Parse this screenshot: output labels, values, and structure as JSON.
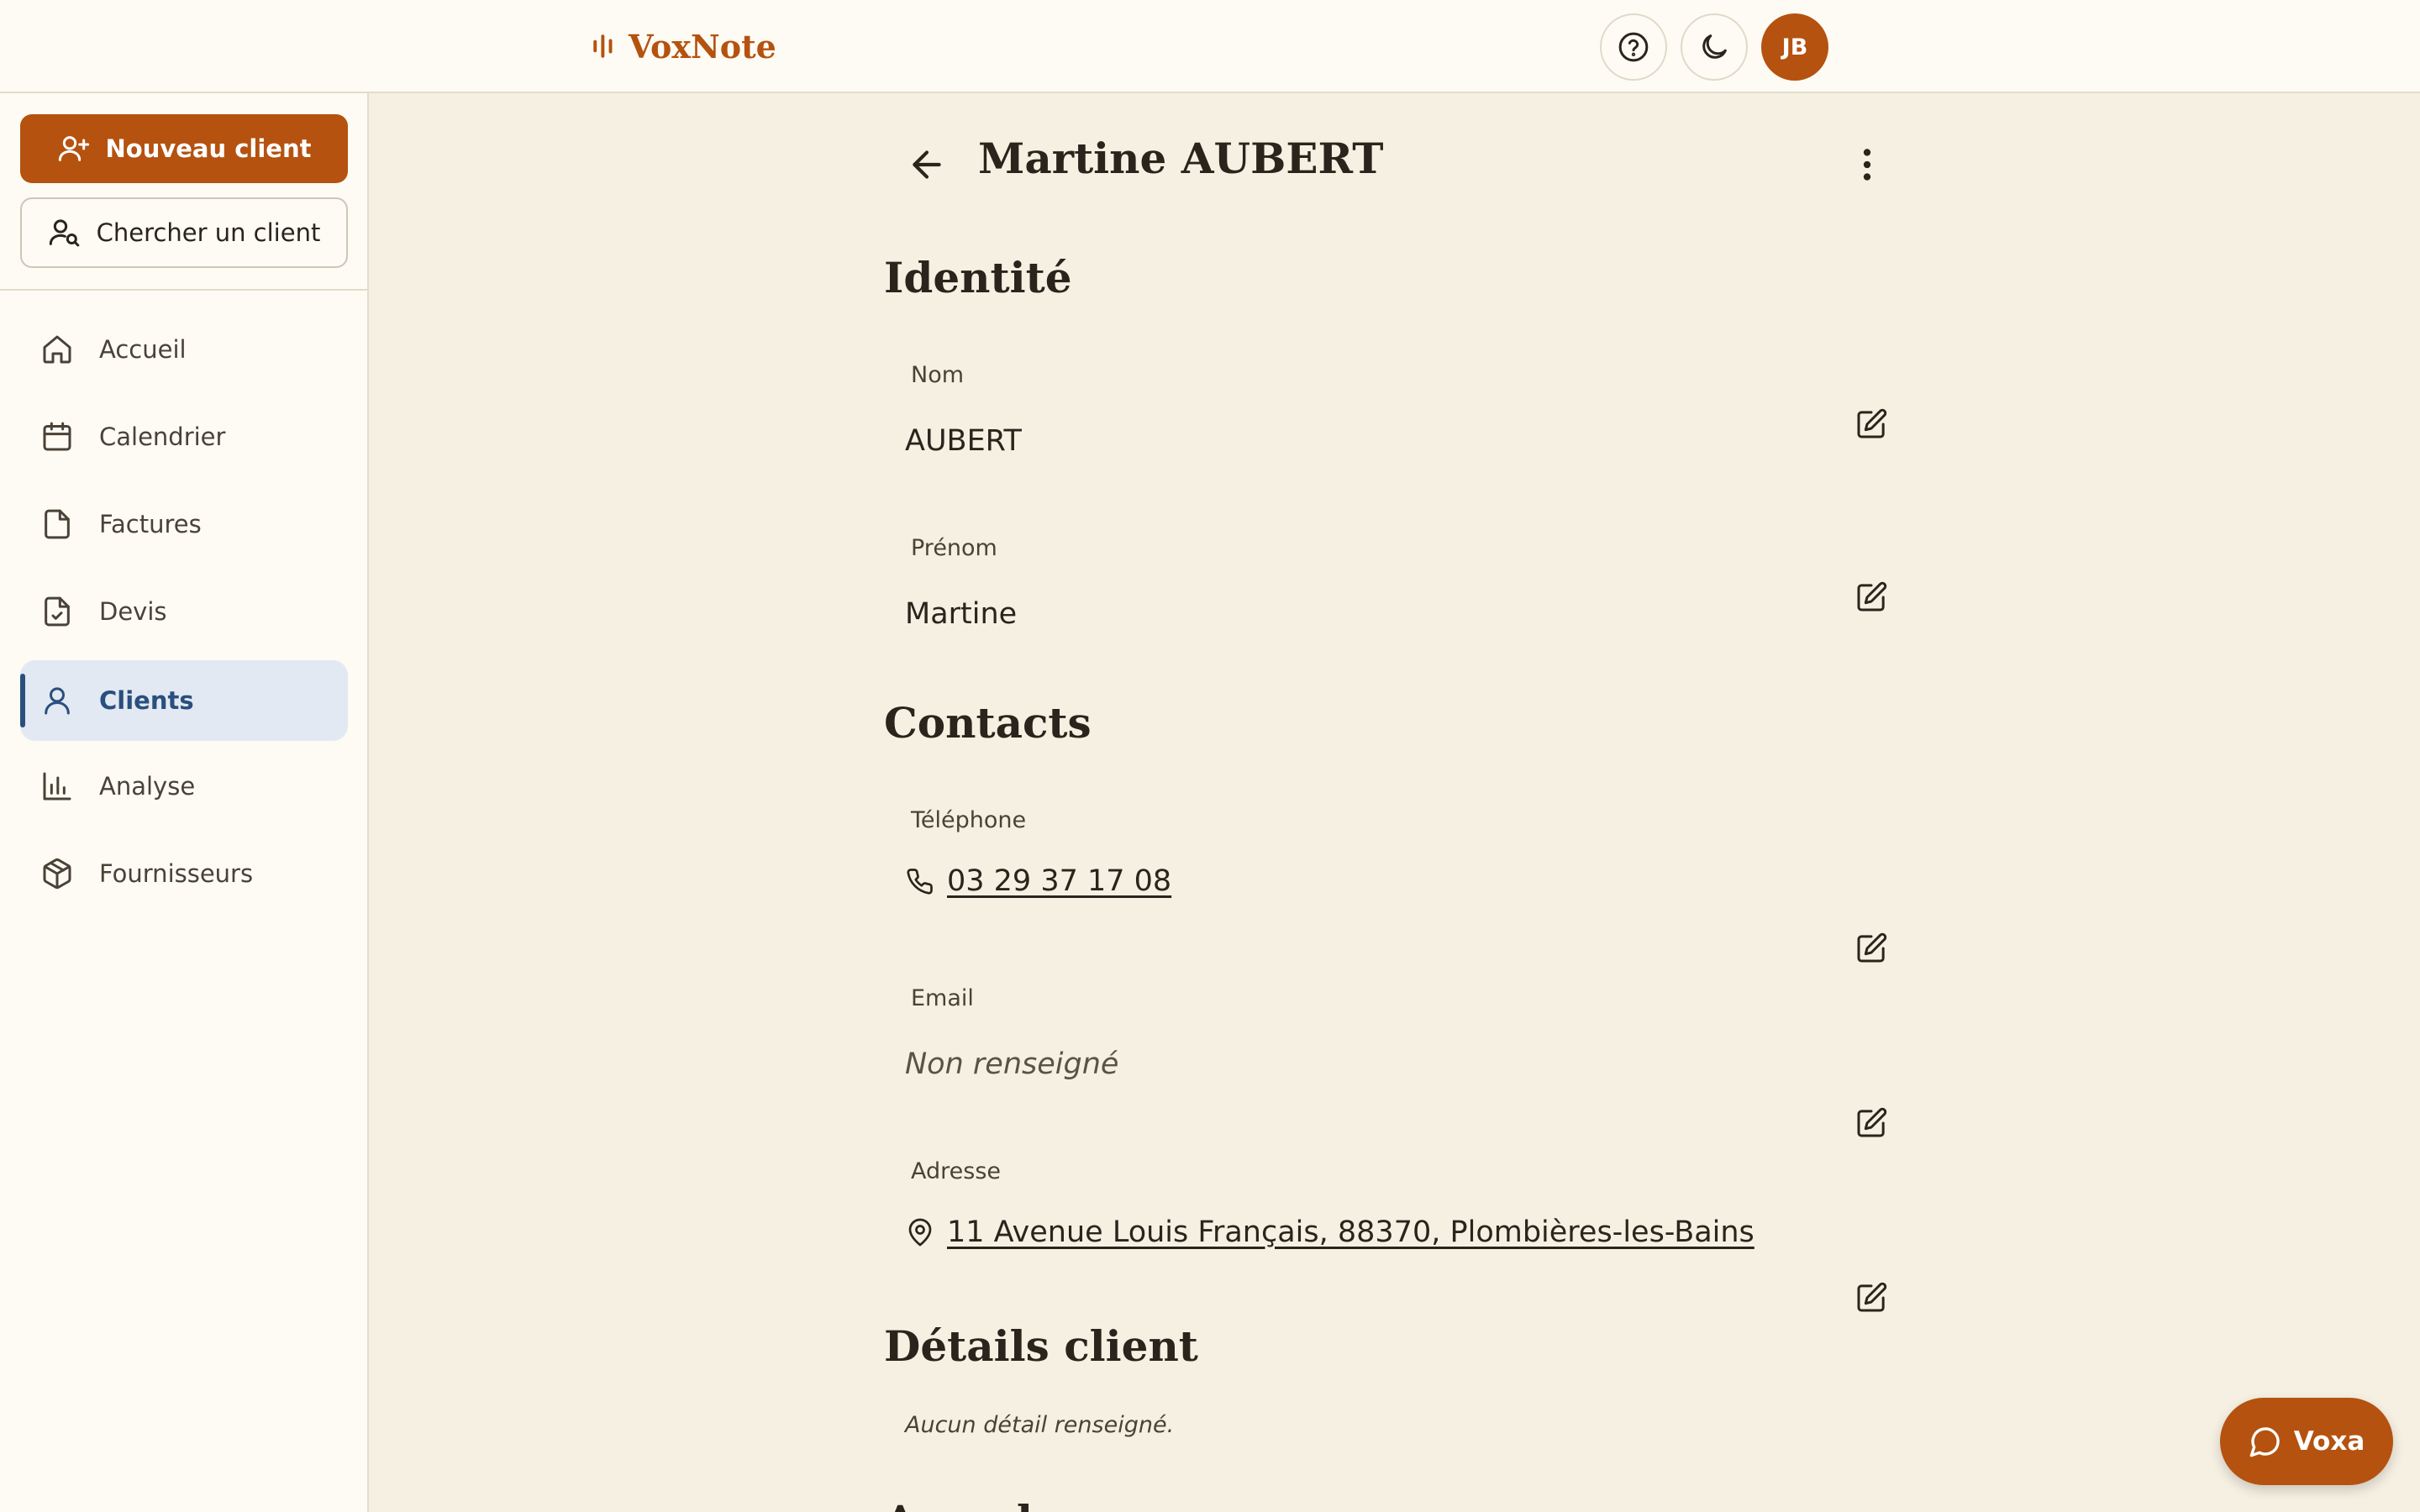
{
  "app": {
    "name": "VoxNote",
    "user_initials": "JB"
  },
  "colors": {
    "accent": "#b5520f",
    "active_nav": "#2a4f7e",
    "active_nav_bg": "#e2e9f2"
  },
  "sidebar": {
    "new_client_label": "Nouveau client",
    "search_client_label": "Chercher un client",
    "items": [
      {
        "label": "Accueil",
        "icon": "home-icon"
      },
      {
        "label": "Calendrier",
        "icon": "calendar-icon"
      },
      {
        "label": "Factures",
        "icon": "file-icon"
      },
      {
        "label": "Devis",
        "icon": "file-check-icon"
      },
      {
        "label": "Clients",
        "icon": "user-icon",
        "active": true
      },
      {
        "label": "Analyse",
        "icon": "bar-chart-icon"
      },
      {
        "label": "Fournisseurs",
        "icon": "package-icon"
      }
    ]
  },
  "client": {
    "title": "Martine AUBERT",
    "sections": {
      "identity": "Identité",
      "contacts": "Contacts",
      "details": "Détails client",
      "next": "Agenda"
    },
    "fields": {
      "nom": {
        "label": "Nom",
        "value": "AUBERT"
      },
      "prenom": {
        "label": "Prénom",
        "value": "Martine"
      },
      "telephone": {
        "label": "Téléphone",
        "value": "03 29 37 17 08"
      },
      "email": {
        "label": "Email",
        "value": "Non renseigné"
      },
      "adresse": {
        "label": "Adresse",
        "value": "11 Avenue Louis Français, 88370, Plombières-les-Bains"
      }
    },
    "details_empty": "Aucun détail renseigné."
  },
  "assistant": {
    "label": "Voxa"
  }
}
